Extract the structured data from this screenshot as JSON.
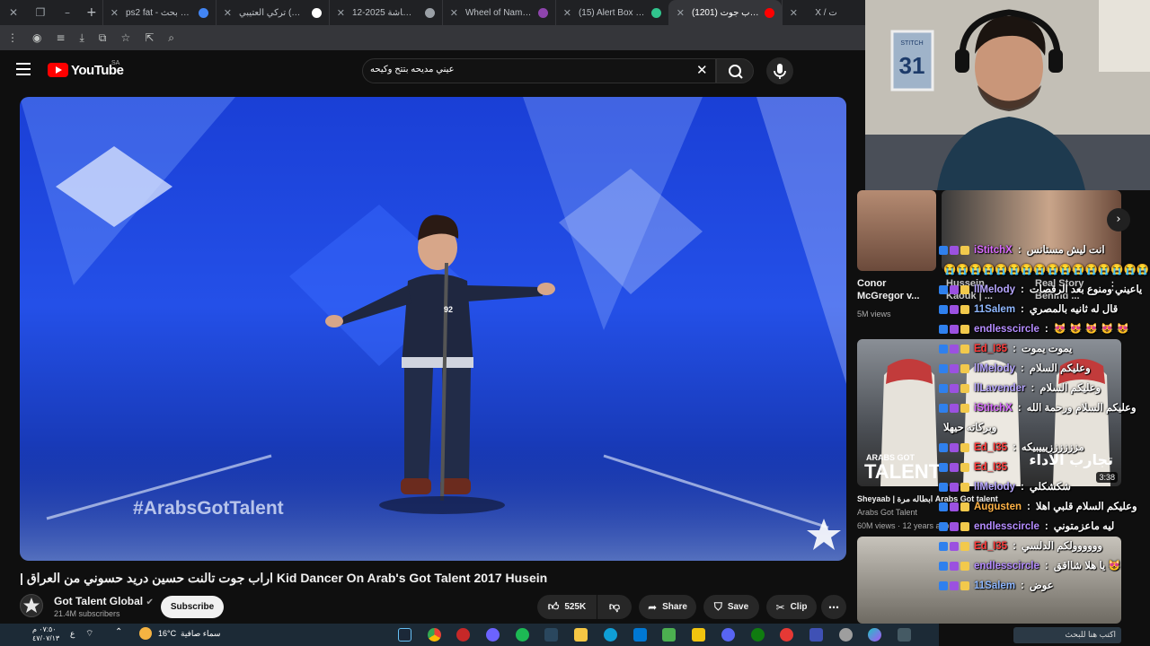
{
  "tabs": [
    {
      "label": "ps2 fat - بحث Google",
      "color": "#4285f4",
      "active": false
    },
    {
      "label": "تركي العتيبي (@z6ij)",
      "color": "#ffffff",
      "active": false
    },
    {
      "label": "لقطة الشاشة 2025-12",
      "color": "#9aa0a6",
      "active": false
    },
    {
      "label": "Wheel of Names | ...",
      "color": "#8e44ad",
      "active": false
    },
    {
      "label": "(15) Alert Box / Stream",
      "color": "#31c48d",
      "active": false
    },
    {
      "label": "(1201) اراب جوت",
      "color": "#ff0000",
      "active": true
    },
    {
      "label": "X / ت",
      "color": "#ffffff",
      "active": false
    }
  ],
  "youtube": {
    "logo_text": "YouTube",
    "country_code": "SA",
    "search_query": "عيني مديحه بتتح وكيحه"
  },
  "video": {
    "title": "| اراب جوت تالنت حسين دريد حسوني من العراق Kid Dancer On Arab's Got Talent 2017 Husein",
    "watermark": "#ArabsGotTalent",
    "shirt_number": "92"
  },
  "channel": {
    "name": "Got Talent Global",
    "subscribers": "21.4M subscribers",
    "subscribe_label": "Subscribe"
  },
  "actions": {
    "likes": "525K",
    "share": "Share",
    "save": "Save",
    "clip": "Clip"
  },
  "sidebar": [
    {
      "title_line1": "Conor",
      "title_line2": "McGregor v...",
      "meta": "5M views"
    },
    {
      "title_line1": "Hussein",
      "title_line2": "Kaouk | ...",
      "meta": ""
    },
    {
      "title_line1": "Real Story",
      "title_line2": "Behind ...",
      "meta": ""
    },
    {
      "title_line1": "Sheyaab | ابطاله مرة Arabs Got talent",
      "title_line2": "Arabs Got Talent",
      "meta": "60M views · 12 years ago",
      "duration": "3:38",
      "thumb_caption": "تجارب الأداء"
    }
  ],
  "chat": [
    {
      "user": "iStitchX",
      "text": "انت ليش مستانس",
      "color": "#d96bff"
    },
    {
      "user": "",
      "text": "😭😭😭😭😭😭😭😭😭😭😭😭😭😭😭😭",
      "color": "#ffffff"
    },
    {
      "user": "llMelody",
      "text": "ياعيني ومنوع بعد الرقصات",
      "color": "#b7a6ff"
    },
    {
      "user": "11Salem",
      "text": "قال له ثانيه بالمصري",
      "color": "#8fb8ff"
    },
    {
      "user": "endlesscircle",
      "text": "😻 😻 😻 😻 😻",
      "color": "#b58cff"
    },
    {
      "user": "Ed_I35",
      "text": "يموت يموت",
      "color": "#ff3b3b"
    },
    {
      "user": "llMelody",
      "text": "وعليكم السلام",
      "color": "#b7a6ff"
    },
    {
      "user": "llLavender",
      "text": "وعليكم السلام",
      "color": "#b7a6ff"
    },
    {
      "user": "iStitchX",
      "text": "وعليكم السلام ورحمة الله",
      "color": "#d96bff"
    },
    {
      "user": "",
      "text": "وبركاته حيهلا",
      "color": "#ffffff"
    },
    {
      "user": "Ed_I35",
      "text": "مززززززيييبيكه",
      "color": "#ff3b3b"
    },
    {
      "user": "Ed_I35",
      "text": "",
      "color": "#ff3b3b"
    },
    {
      "user": "llMelody",
      "text": "شكشكلي",
      "color": "#b7a6ff"
    },
    {
      "user": "Augusten",
      "text": "وعليكم السلام قلبي اهلا",
      "color": "#ffb347"
    },
    {
      "user": "endlesscircle",
      "text": "ليه ماعزمتوني",
      "color": "#b58cff"
    },
    {
      "user": "Ed_I35",
      "text": "وووووولكم الدلسي",
      "color": "#ff3b3b"
    },
    {
      "user": "endlesscircle",
      "text": "يا هلا شااقق 😻",
      "color": "#b58cff"
    },
    {
      "user": "11Salem",
      "text": "عوض",
      "color": "#8fb8ff"
    }
  ],
  "taskbar": {
    "weather_temp": "16°C",
    "weather_text": "سماء صافية",
    "time": "٠٧:٥٠ م",
    "date": "٤٧/٠٧/١٣",
    "lang": "ع",
    "search_placeholder": "اكتب هنا للبحث"
  },
  "webcam": {
    "jersey_number": "31",
    "jersey_name": "STITCH"
  }
}
